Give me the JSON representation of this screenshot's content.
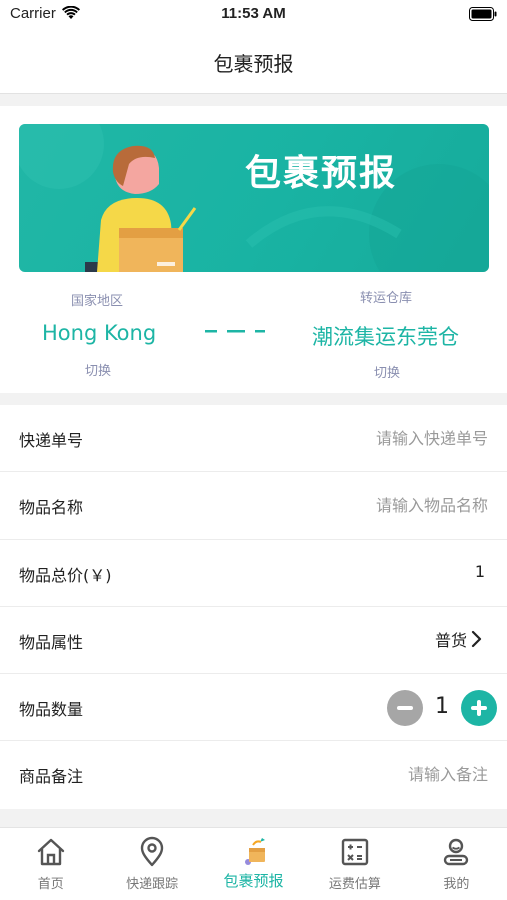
{
  "status_bar": {
    "carrier": "Carrier",
    "time": "11:53 AM"
  },
  "nav": {
    "title": "包裹预报"
  },
  "banner": {
    "title": "包裹预报"
  },
  "route": {
    "origin_label": "国家地区",
    "origin_value": "Hong Kong",
    "origin_switch": "切换",
    "dest_label": "转运仓库",
    "dest_value": "潮流集运东莞仓",
    "dest_switch": "切换"
  },
  "form": {
    "tracking": {
      "label": "快递单号",
      "placeholder": "请输入快递单号"
    },
    "item_name": {
      "label": "物品名称",
      "placeholder": "请输入物品名称"
    },
    "total_price": {
      "label": "物品总价(￥)",
      "value": "1"
    },
    "attribute": {
      "label": "物品属性",
      "value": "普货"
    },
    "quantity": {
      "label": "物品数量",
      "value": "1"
    },
    "remark": {
      "label": "商品备注",
      "placeholder": "请输入备注"
    }
  },
  "tabs": [
    {
      "label": "首页",
      "icon": "home-icon"
    },
    {
      "label": "快递跟踪",
      "icon": "location-pin-icon"
    },
    {
      "label": "包裹预报",
      "icon": "package-icon",
      "active": true
    },
    {
      "label": "运费估算",
      "icon": "calculator-icon"
    },
    {
      "label": "我的",
      "icon": "profile-icon"
    }
  ],
  "colors": {
    "accent": "#1db5a5",
    "muted_label": "#8a8fb0"
  }
}
